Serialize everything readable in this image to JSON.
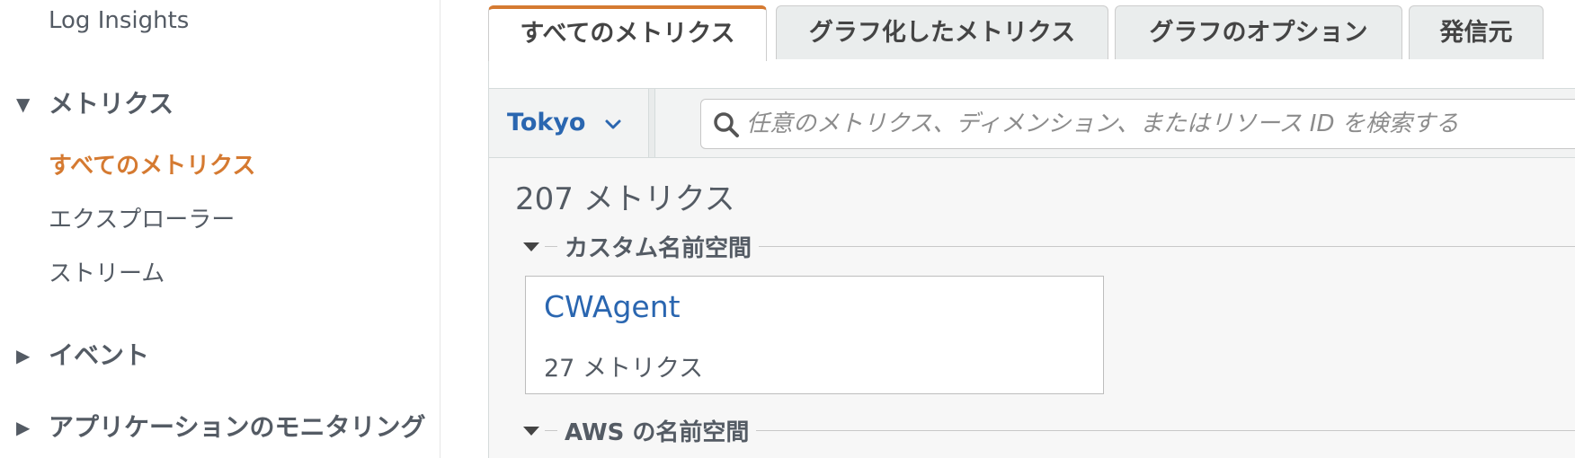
{
  "sidebar": {
    "log_insights": "Log Insights",
    "metrics_section": "メトリクス",
    "items": [
      {
        "label": "すべてのメトリクス"
      },
      {
        "label": "エクスプローラー"
      },
      {
        "label": "ストリーム"
      }
    ],
    "events_section": "イベント",
    "app_monitoring_section": "アプリケーションのモニタリング"
  },
  "tabs": [
    {
      "label": "すべてのメトリクス"
    },
    {
      "label": "グラフ化したメトリクス"
    },
    {
      "label": "グラフのオプション"
    },
    {
      "label": "発信元"
    }
  ],
  "toolbar": {
    "region": "Tokyo",
    "search_placeholder": "任意のメトリクス、ディメンション、またはリソース ID を検索する"
  },
  "content": {
    "metric_count": "207 メトリクス",
    "custom_namespace_header": "カスタム名前空間",
    "custom_namespaces": [
      {
        "name": "CWAgent",
        "count": "27 メトリクス"
      }
    ],
    "aws_namespace_header": "AWS の名前空間"
  },
  "colors": {
    "accent_orange": "#d57a31",
    "link_blue": "#2a66b0",
    "text_gray": "#545b64"
  },
  "icons": {
    "section_expanded": "triangle-down-icon",
    "section_collapsed": "triangle-right-icon",
    "region_dropdown": "chevron-down-icon",
    "search": "search-icon"
  }
}
